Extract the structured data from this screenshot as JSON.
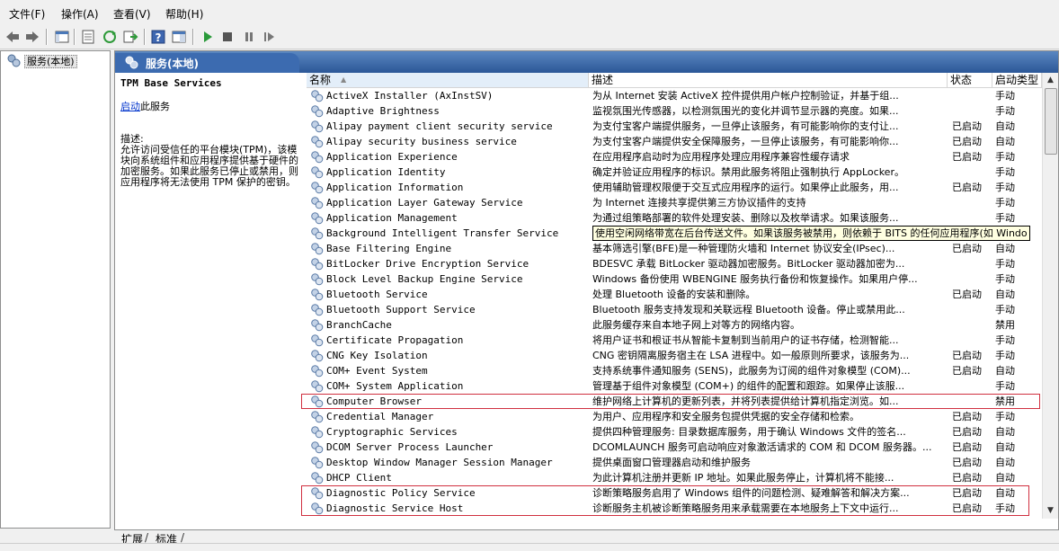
{
  "menu": [
    "文件(F)",
    "操作(A)",
    "查看(V)",
    "帮助(H)"
  ],
  "toolbar": [
    "back-icon",
    "forward-icon",
    "console-tree-icon",
    "properties-icon",
    "refresh-icon",
    "export-icon",
    "help-icon",
    "show-pane-icon",
    "start-icon",
    "stop-icon",
    "pause-icon",
    "restart-icon"
  ],
  "tree": {
    "root_label": "服务(本地)"
  },
  "pane": {
    "title": "服务(本地)",
    "detail": {
      "service_name": "TPM Base Services",
      "start_link": "启动",
      "start_suffix": "此服务",
      "desc_label": "描述:",
      "desc_text": "允许访问受信任的平台模块(TPM)，该模块向系统组件和应用程序提供基于硬件的加密服务。如果此服务已停止或禁用，则应用程序将无法使用 TPM 保护的密钥。"
    },
    "columns": {
      "name": "名称",
      "desc": "描述",
      "status": "状态",
      "start": "启动类型"
    }
  },
  "rows": [
    {
      "name": "ActiveX Installer (AxInstSV)",
      "desc": "为从 Internet 安装 ActiveX 控件提供用户帐户控制验证，并基于组...",
      "status": "",
      "start": "手动"
    },
    {
      "name": "Adaptive Brightness",
      "desc": "监视氛围光传感器，以检测氛围光的变化并调节显示器的亮度。如果...",
      "status": "",
      "start": "手动"
    },
    {
      "name": "Alipay payment client security service",
      "desc": "为支付宝客户端提供服务，一旦停止该服务，有可能影响你的支付让...",
      "status": "已启动",
      "start": "自动"
    },
    {
      "name": "Alipay security business service",
      "desc": "为支付宝客户端提供安全保障服务，一旦停止该服务，有可能影响你...",
      "status": "已启动",
      "start": "自动"
    },
    {
      "name": "Application Experience",
      "desc": "在应用程序启动时为应用程序处理应用程序兼容性缓存请求",
      "status": "已启动",
      "start": "手动"
    },
    {
      "name": "Application Identity",
      "desc": "确定并验证应用程序的标识。禁用此服务将阻止强制执行 AppLocker。",
      "status": "",
      "start": "手动"
    },
    {
      "name": "Application Information",
      "desc": "使用辅助管理权限便于交互式应用程序的运行。如果停止此服务，用...",
      "status": "已启动",
      "start": "手动"
    },
    {
      "name": "Application Layer Gateway Service",
      "desc": "为 Internet 连接共享提供第三方协议插件的支持",
      "status": "",
      "start": "手动"
    },
    {
      "name": "Application Management",
      "desc": "为通过组策略部署的软件处理安装、删除以及枚举请求。如果该服务...",
      "status": "",
      "start": "手动"
    },
    {
      "name": "Background Intelligent Transfer Service",
      "desc": "使用空闲网络带宽在后台传送文件。如果该服务被禁用，则依赖于 BITS 的任何应用程序(如 Windo",
      "status": "",
      "start": "",
      "tooltip": true
    },
    {
      "name": "Base Filtering Engine",
      "desc": "基本筛选引擎(BFE)是一种管理防火墙和 Internet 协议安全(IPsec)...",
      "status": "已启动",
      "start": "自动"
    },
    {
      "name": "BitLocker Drive Encryption Service",
      "desc": "BDESVC 承载 BitLocker 驱动器加密服务。BitLocker 驱动器加密为...",
      "status": "",
      "start": "手动"
    },
    {
      "name": "Block Level Backup Engine Service",
      "desc": "Windows 备份使用 WBENGINE 服务执行备份和恢复操作。如果用户停...",
      "status": "",
      "start": "手动"
    },
    {
      "name": "Bluetooth Service",
      "desc": "处理 Bluetooth 设备的安装和删除。",
      "status": "已启动",
      "start": "自动"
    },
    {
      "name": "Bluetooth Support Service",
      "desc": "Bluetooth 服务支持发现和关联远程 Bluetooth 设备。停止或禁用此...",
      "status": "",
      "start": "手动"
    },
    {
      "name": "BranchCache",
      "desc": "此服务缓存来自本地子网上对等方的网络内容。",
      "status": "",
      "start": "禁用"
    },
    {
      "name": "Certificate Propagation",
      "desc": "将用户证书和根证书从智能卡复制到当前用户的证书存储，检测智能...",
      "status": "",
      "start": "手动"
    },
    {
      "name": "CNG Key Isolation",
      "desc": "CNG 密钥隔离服务宿主在 LSA 进程中。如一般原则所要求，该服务为...",
      "status": "已启动",
      "start": "手动"
    },
    {
      "name": "COM+ Event System",
      "desc": "支持系统事件通知服务 (SENS)，此服务为订阅的组件对象模型 (COM)...",
      "status": "已启动",
      "start": "自动"
    },
    {
      "name": "COM+ System Application",
      "desc": "管理基于组件对象模型 (COM+) 的组件的配置和跟踪。如果停止该服...",
      "status": "",
      "start": "手动"
    },
    {
      "name": "Computer Browser",
      "desc": "维护网络上计算机的更新列表，并将列表提供给计算机指定浏览。如...",
      "status": "",
      "start": "禁用",
      "highlight": true
    },
    {
      "name": "Credential Manager",
      "desc": "为用户、应用程序和安全服务包提供凭据的安全存储和检索。",
      "status": "已启动",
      "start": "手动"
    },
    {
      "name": "Cryptographic Services",
      "desc": "提供四种管理服务: 目录数据库服务，用于确认 Windows 文件的签名...",
      "status": "已启动",
      "start": "自动"
    },
    {
      "name": "DCOM Server Process Launcher",
      "desc": "DCOMLAUNCH 服务可启动响应对象激活请求的 COM 和 DCOM 服务器。...",
      "status": "已启动",
      "start": "自动"
    },
    {
      "name": "Desktop Window Manager Session Manager",
      "desc": "提供桌面窗口管理器启动和维护服务",
      "status": "已启动",
      "start": "自动"
    },
    {
      "name": "DHCP Client",
      "desc": "为此计算机注册并更新 IP 地址。如果此服务停止，计算机将不能接...",
      "status": "已启动",
      "start": "自动"
    },
    {
      "name": "Diagnostic Policy Service",
      "desc": "诊断策略服务启用了 Windows 组件的问题检测、疑难解答和解决方案...",
      "status": "已启动",
      "start": "自动",
      "highlight2": true
    },
    {
      "name": "Diagnostic Service Host",
      "desc": "诊断服务主机被诊断策略服务用来承载需要在本地服务上下文中运行...",
      "status": "已启动",
      "start": "手动",
      "highlight2": true
    }
  ],
  "bottom_tabs": [
    "扩展",
    "标准"
  ],
  "colors": {
    "header_blue": "#2b5797",
    "highlight_red": "#d03040",
    "tooltip_bg": "#ffffe1",
    "link": "#0033cc"
  }
}
